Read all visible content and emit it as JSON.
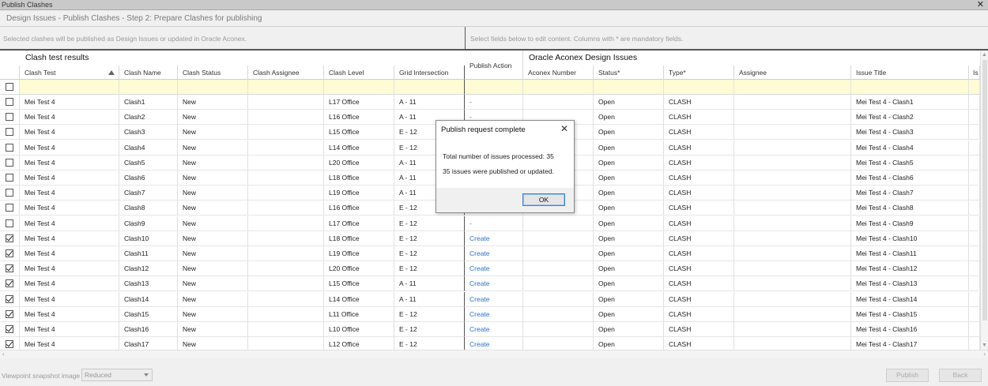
{
  "window": {
    "title": "Publish Clashes",
    "close_glyph": "✕"
  },
  "step_title": "Design Issues - Publish Clashes - Step 2: Prepare Clashes for publishing",
  "info": {
    "left": "Selected clashes will be published as Design Issues or updated in Oracle Aconex.",
    "right": "Select fields below to edit content. Columns with * are mandatory fields."
  },
  "groups": {
    "left": "Clash test results",
    "right": "Oracle Aconex Design Issues"
  },
  "columns": {
    "clash_test": "Clash Test",
    "clash_name": "Clash Name",
    "clash_status": "Clash Status",
    "clash_assignee": "Clash Assignee",
    "clash_level": "Clash Level",
    "grid_intersection": "Grid Intersection",
    "publish_action": "Publish Action",
    "aconex_number": "Aconex Number",
    "status": "Status*",
    "type": "Type*",
    "assignee": "Assignee",
    "issue_title": "Issue Title",
    "extra": "Is"
  },
  "rows": [
    {
      "checked": false,
      "test": "Mei Test 4",
      "name": "Clash1",
      "cstatus": "New",
      "level": "L17 Office",
      "grid": "A - 11",
      "action": "-",
      "status": "Open",
      "type": "CLASH",
      "title": "Mei Test 4 - Clash1"
    },
    {
      "checked": false,
      "test": "Mei Test 4",
      "name": "Clash2",
      "cstatus": "New",
      "level": "L16 Office",
      "grid": "A - 11",
      "action": "-",
      "status": "Open",
      "type": "CLASH",
      "title": "Mei Test 4 - Clash2"
    },
    {
      "checked": false,
      "test": "Mei Test 4",
      "name": "Clash3",
      "cstatus": "New",
      "level": "L15 Office",
      "grid": "E - 12",
      "action": "",
      "status": "Open",
      "type": "CLASH",
      "title": "Mei Test 4 - Clash3"
    },
    {
      "checked": false,
      "test": "Mei Test 4",
      "name": "Clash4",
      "cstatus": "New",
      "level": "L14 Office",
      "grid": "E - 12",
      "action": "",
      "status": "Open",
      "type": "CLASH",
      "title": "Mei Test 4 - Clash4"
    },
    {
      "checked": false,
      "test": "Mei Test 4",
      "name": "Clash5",
      "cstatus": "New",
      "level": "L20 Office",
      "grid": "A - 11",
      "action": "",
      "status": "Open",
      "type": "CLASH",
      "title": "Mei Test 4 - Clash5"
    },
    {
      "checked": false,
      "test": "Mei Test 4",
      "name": "Clash6",
      "cstatus": "New",
      "level": "L18 Office",
      "grid": "A - 11",
      "action": "",
      "status": "Open",
      "type": "CLASH",
      "title": "Mei Test 4 - Clash6"
    },
    {
      "checked": false,
      "test": "Mei Test 4",
      "name": "Clash7",
      "cstatus": "New",
      "level": "L19 Office",
      "grid": "A - 11",
      "action": "",
      "status": "Open",
      "type": "CLASH",
      "title": "Mei Test 4 - Clash7"
    },
    {
      "checked": false,
      "test": "Mei Test 4",
      "name": "Clash8",
      "cstatus": "New",
      "level": "L16 Office",
      "grid": "E - 12",
      "action": "",
      "status": "Open",
      "type": "CLASH",
      "title": "Mei Test 4 - Clash8"
    },
    {
      "checked": false,
      "test": "Mei Test 4",
      "name": "Clash9",
      "cstatus": "New",
      "level": "L17 Office",
      "grid": "E - 12",
      "action": "-",
      "status": "Open",
      "type": "CLASH",
      "title": "Mei Test 4 - Clash9"
    },
    {
      "checked": true,
      "test": "Mei Test 4",
      "name": "Clash10",
      "cstatus": "New",
      "level": "L18 Office",
      "grid": "E - 12",
      "action": "Create",
      "status": "Open",
      "type": "CLASH",
      "title": "Mei Test 4 - Clash10"
    },
    {
      "checked": true,
      "test": "Mei Test 4",
      "name": "Clash11",
      "cstatus": "New",
      "level": "L19 Office",
      "grid": "E - 12",
      "action": "Create",
      "status": "Open",
      "type": "CLASH",
      "title": "Mei Test 4 - Clash11"
    },
    {
      "checked": true,
      "test": "Mei Test 4",
      "name": "Clash12",
      "cstatus": "New",
      "level": "L20 Office",
      "grid": "E - 12",
      "action": "Create",
      "status": "Open",
      "type": "CLASH",
      "title": "Mei Test 4 - Clash12"
    },
    {
      "checked": true,
      "test": "Mei Test 4",
      "name": "Clash13",
      "cstatus": "New",
      "level": "L15 Office",
      "grid": "A - 11",
      "action": "Create",
      "status": "Open",
      "type": "CLASH",
      "title": "Mei Test 4 - Clash13"
    },
    {
      "checked": true,
      "test": "Mei Test 4",
      "name": "Clash14",
      "cstatus": "New",
      "level": "L14 Office",
      "grid": "A - 11",
      "action": "Create",
      "status": "Open",
      "type": "CLASH",
      "title": "Mei Test 4 - Clash14"
    },
    {
      "checked": true,
      "test": "Mei Test 4",
      "name": "Clash15",
      "cstatus": "New",
      "level": "L11 Office",
      "grid": "E - 12",
      "action": "Create",
      "status": "Open",
      "type": "CLASH",
      "title": "Mei Test 4 - Clash15"
    },
    {
      "checked": true,
      "test": "Mei Test 4",
      "name": "Clash16",
      "cstatus": "New",
      "level": "L10 Office",
      "grid": "E - 12",
      "action": "Create",
      "status": "Open",
      "type": "CLASH",
      "title": "Mei Test 4 - Clash16"
    },
    {
      "checked": true,
      "test": "Mei Test 4",
      "name": "Clash17",
      "cstatus": "New",
      "level": "L12 Office",
      "grid": "E - 12",
      "action": "Create",
      "status": "Open",
      "type": "CLASH",
      "title": "Mei Test 4 - Clash17"
    }
  ],
  "bottom": {
    "snapshot_label": "Viewpoint snapshot image",
    "snapshot_value": "Reduced",
    "publish_label": "Publish",
    "back_label": "Back"
  },
  "dialog": {
    "title": "Publish request complete",
    "close_glyph": "✕",
    "line1": "Total number of issues processed: 35",
    "line2": "35 issues were published or updated.",
    "ok_label": "OK"
  },
  "colors": {
    "link": "#2c73c9",
    "filter_row": "#fffbd5",
    "dialog_focus": "#3c7fd0"
  }
}
